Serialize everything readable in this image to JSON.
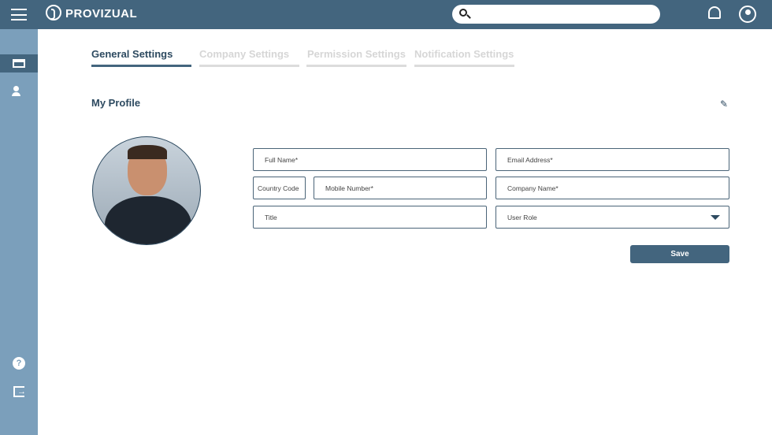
{
  "header": {
    "brand": "PROVIZUAL",
    "search_placeholder": ""
  },
  "tabs": [
    {
      "label": "General Settings",
      "active": true
    },
    {
      "label": "Company Settings"
    },
    {
      "label": "Permission Settings"
    },
    {
      "label": "Notification Settings"
    }
  ],
  "profile": {
    "title": "My Profile",
    "fields": {
      "full_name": "Full Name*",
      "email": "Email Address*",
      "country_code": "Country Code",
      "mobile": "Mobile Number*",
      "company": "Company Name*",
      "title": "Title",
      "user_role": "User Role"
    },
    "save": "Save"
  },
  "colors": {
    "primary": "#43657e",
    "sidebar": "#7b9fbb"
  }
}
